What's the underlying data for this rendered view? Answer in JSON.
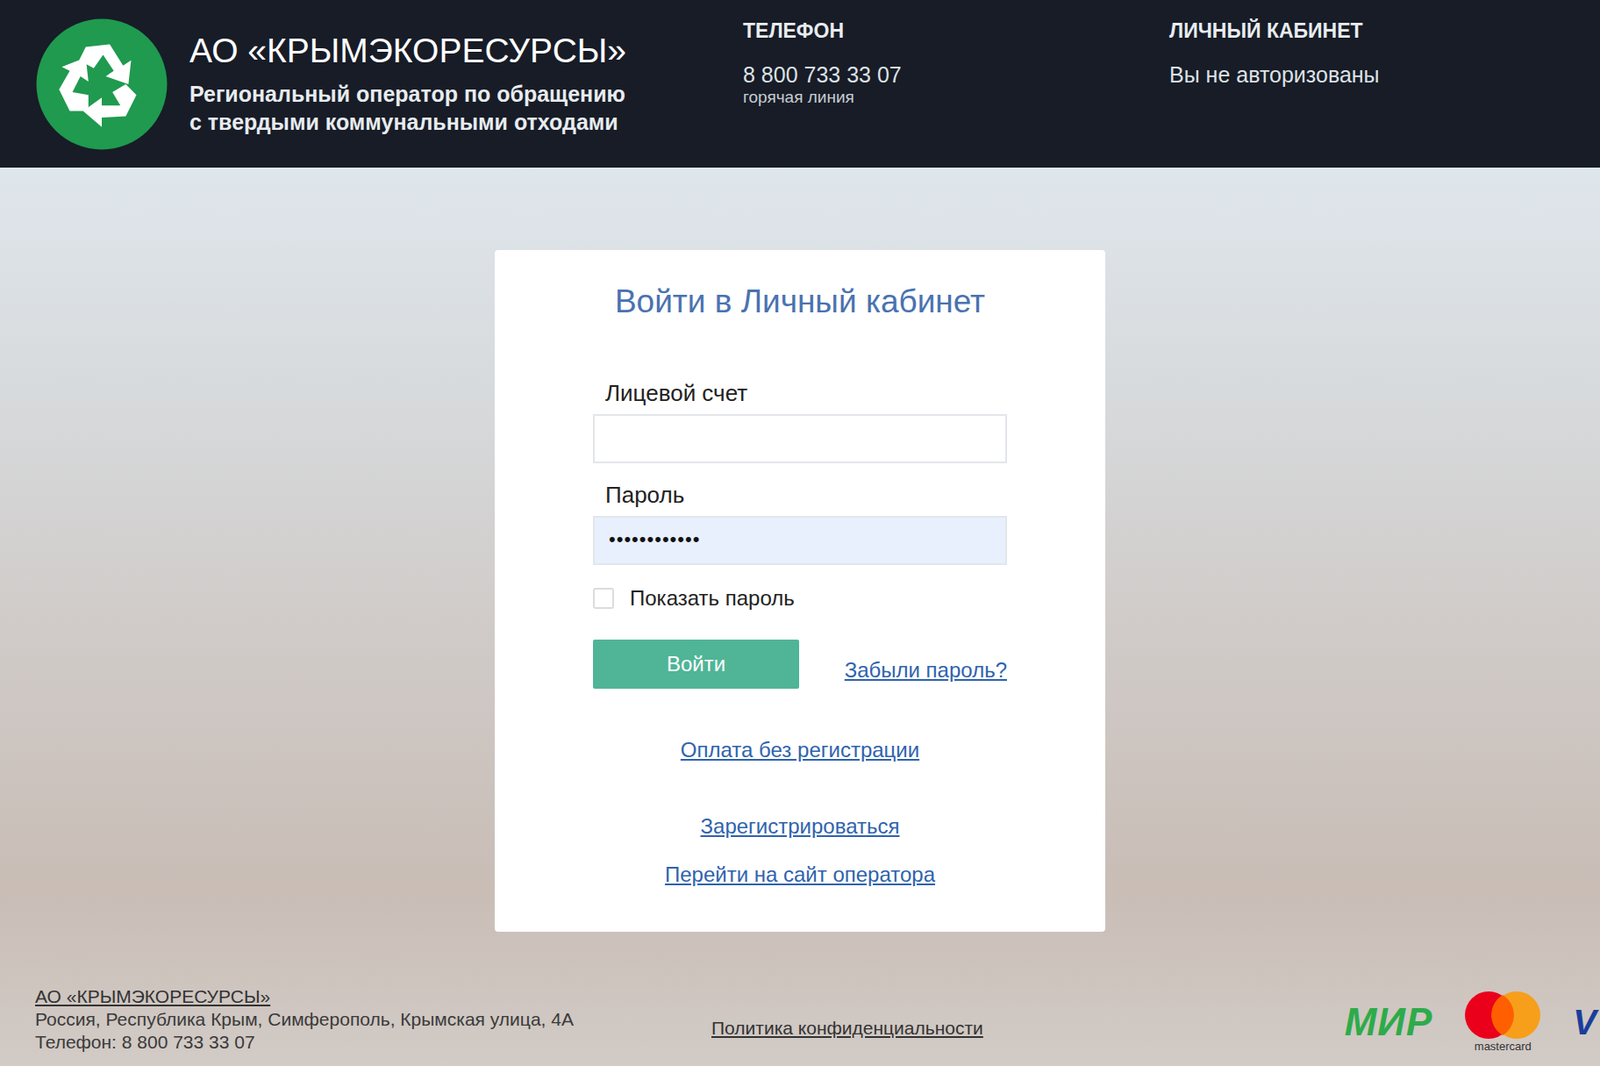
{
  "header": {
    "logo_title": "АО «КРЫМЭКОРЕСУРСЫ»",
    "logo_subtitle": [
      "Региональный оператор по обращению",
      "с твердыми коммунальными отходами"
    ],
    "phone": {
      "label": "ТЕЛЕФОН",
      "number": "8 800 733 33 07",
      "caption": "горячая линия"
    },
    "cabinet": {
      "label": "ЛИЧНЫЙ КАБИНЕТ",
      "status": "Вы не авторизованы"
    }
  },
  "login": {
    "title": "Войти в Личный кабинет",
    "fields": [
      {
        "label": "Лицевой счет",
        "value": "",
        "filled": false
      },
      {
        "label": "Пароль",
        "value": "••••••••••••",
        "filled": true
      }
    ],
    "show_password": {
      "label": "Показать пароль",
      "checked": false
    },
    "submit": "Войти",
    "forgot": "Забыли пароль?",
    "links": [
      "Оплата без регистрации",
      "Зарегистрироваться",
      "Перейти на сайт оператора"
    ]
  },
  "footer": {
    "company": "АО «КРЫМЭКОРЕСУРСЫ»",
    "address": "Россия, Республика Крым, Симферополь, Крымская улица, 4А",
    "phone": "Телефон: 8 800 733 33 07",
    "privacy": "Политика конфиденциальности",
    "payments": [
      {
        "name": "МИР",
        "kind": "mir"
      },
      {
        "name": "mastercard",
        "kind": "mastercard"
      },
      {
        "name": "V",
        "kind": "visa"
      }
    ]
  }
}
